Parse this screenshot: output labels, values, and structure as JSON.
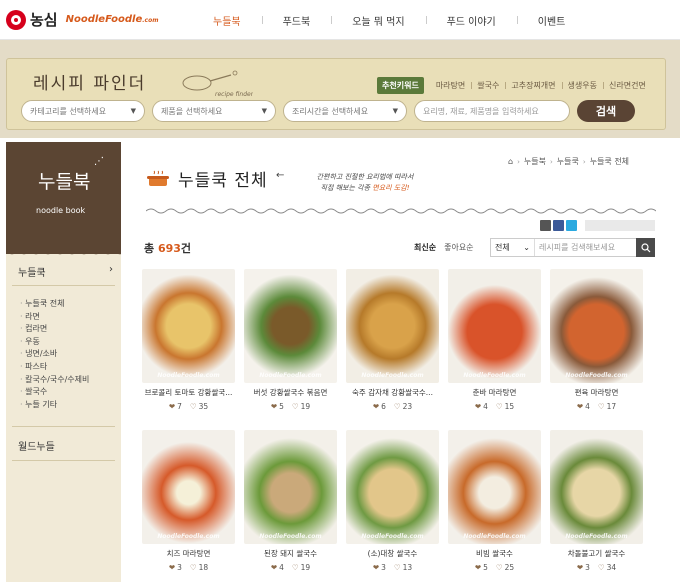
{
  "header": {
    "brand": "농심",
    "brand_sub": "NoodleFoodle",
    "brand_sub_small": ".com",
    "nav": [
      "누들북",
      "푸드북",
      "오늘 뭐 먹지",
      "푸드 이야기",
      "이벤트"
    ]
  },
  "finder": {
    "title": "레시피 파인더",
    "deco_caption": "recipe finder",
    "keyword_badge": "추천키워드",
    "keywords": [
      "마라탕면",
      "쌀국수",
      "고추장찌개면",
      "생생우동",
      "신라면건면"
    ],
    "category_placeholder": "카테고리를 선택하세요",
    "product_placeholder": "제품을 선택하세요",
    "time_placeholder": "조리시간을 선택하세요",
    "search_placeholder": "요리명, 재료, 제품명을 입력하세요",
    "search_button": "검색"
  },
  "sidebar": {
    "title": "누들북",
    "subtitle": "noodle book",
    "section1": "누들쿡",
    "items": [
      "누들쿡 전체",
      "라면",
      "컵라면",
      "우동",
      "냉면/소바",
      "파스타",
      "칼국수/국수/수제비",
      "쌀국수",
      "누들 기타"
    ],
    "section2": "월드누들"
  },
  "main": {
    "title": "누들쿡 전체",
    "note_line1": "간편하고 진절한 요리법에 따라서",
    "note_line2_a": "직접 해보는 각종 ",
    "note_line2_b": "면요리 도감!",
    "breadcrumb": [
      "누들북",
      "누들쿡",
      "누들쿡 전체"
    ],
    "total_prefix": "총 ",
    "total_count": "693",
    "total_suffix": "건",
    "sort": [
      "최신순",
      "좋아요순"
    ],
    "scope": "전체",
    "search_placeholder": "레시피를 검색해보세요",
    "watermark": "NoodleFoodle.com",
    "recipes": [
      {
        "name": "브로콜리 토마토 강황쌀국...",
        "comments": "7",
        "likes": "35"
      },
      {
        "name": "버섯 강황쌀국수 볶음면",
        "comments": "5",
        "likes": "19"
      },
      {
        "name": "숙주 감자채 강황쌀국수...",
        "comments": "6",
        "likes": "23"
      },
      {
        "name": "춘바 마라탕면",
        "comments": "4",
        "likes": "15"
      },
      {
        "name": "편육 마라탕면",
        "comments": "4",
        "likes": "17"
      },
      {
        "name": "치즈 마라탕면",
        "comments": "3",
        "likes": "18"
      },
      {
        "name": "된장 돼지 쌀국수",
        "comments": "4",
        "likes": "19"
      },
      {
        "name": "(소)대창 쌀국수",
        "comments": "3",
        "likes": "13"
      },
      {
        "name": "비빔 쌀국수",
        "comments": "5",
        "likes": "25"
      },
      {
        "name": "차돌불고기 쌀국수",
        "comments": "3",
        "likes": "34"
      }
    ]
  },
  "colors": {
    "accent": "#d65a1c",
    "sidebar_dark": "#5b4533",
    "finder_bg": "#e9dfb8"
  }
}
